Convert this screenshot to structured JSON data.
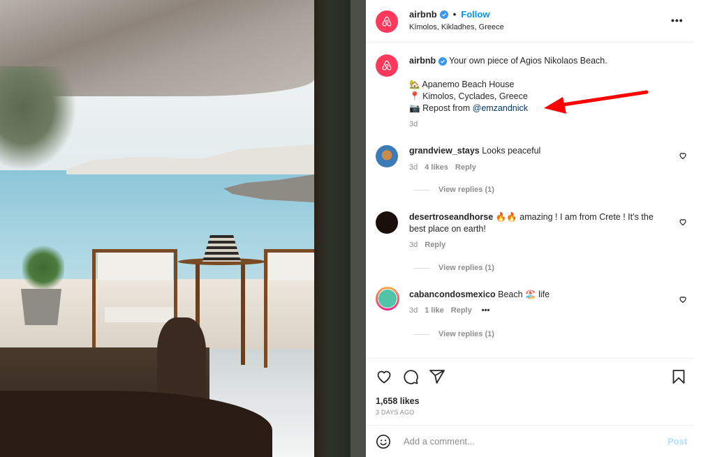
{
  "post": {
    "author": "airbnb",
    "verified": true,
    "follow_label": "Follow",
    "separator": "•",
    "location": "Kímolos, Kikladhes, Greece",
    "more_label": "•••"
  },
  "caption": {
    "author": "airbnb",
    "text": "Your own piece of Agios Nikolaos Beach.",
    "lines": [
      {
        "emoji": "🏡",
        "text": "Apanemo Beach House"
      },
      {
        "emoji": "📍",
        "text": "Kimolos, Cyclades, Greece"
      },
      {
        "emoji": "📷",
        "text": "Repost from ",
        "mention": "@emzandnick"
      }
    ],
    "age": "3d"
  },
  "comments": [
    {
      "username": "grandview_stays",
      "text": "Looks peaceful",
      "age": "3d",
      "likes": "4 likes",
      "reply_label": "Reply",
      "view_replies": "View replies (1)"
    },
    {
      "username": "desertroseandhorse",
      "text": "🔥🔥 amazing ! I am from Crete ! It’s the best place on earth!",
      "age": "3d",
      "likes": "",
      "reply_label": "Reply",
      "view_replies": "View replies (1)"
    },
    {
      "username": "cabancondosmexico",
      "text": "Beach 🏖️ life",
      "age": "3d",
      "likes": "1 like",
      "reply_label": "Reply",
      "more_label": "•••",
      "view_replies": "View replies (1)"
    }
  ],
  "footer": {
    "likes": "1,658 likes",
    "date": "3 DAYS AGO",
    "comment_placeholder": "Add a comment...",
    "post_label": "Post"
  },
  "colors": {
    "brand": "#ff385c",
    "link": "#0095f6",
    "mention": "#00376b",
    "annotation_arrow": "#ff0000"
  }
}
